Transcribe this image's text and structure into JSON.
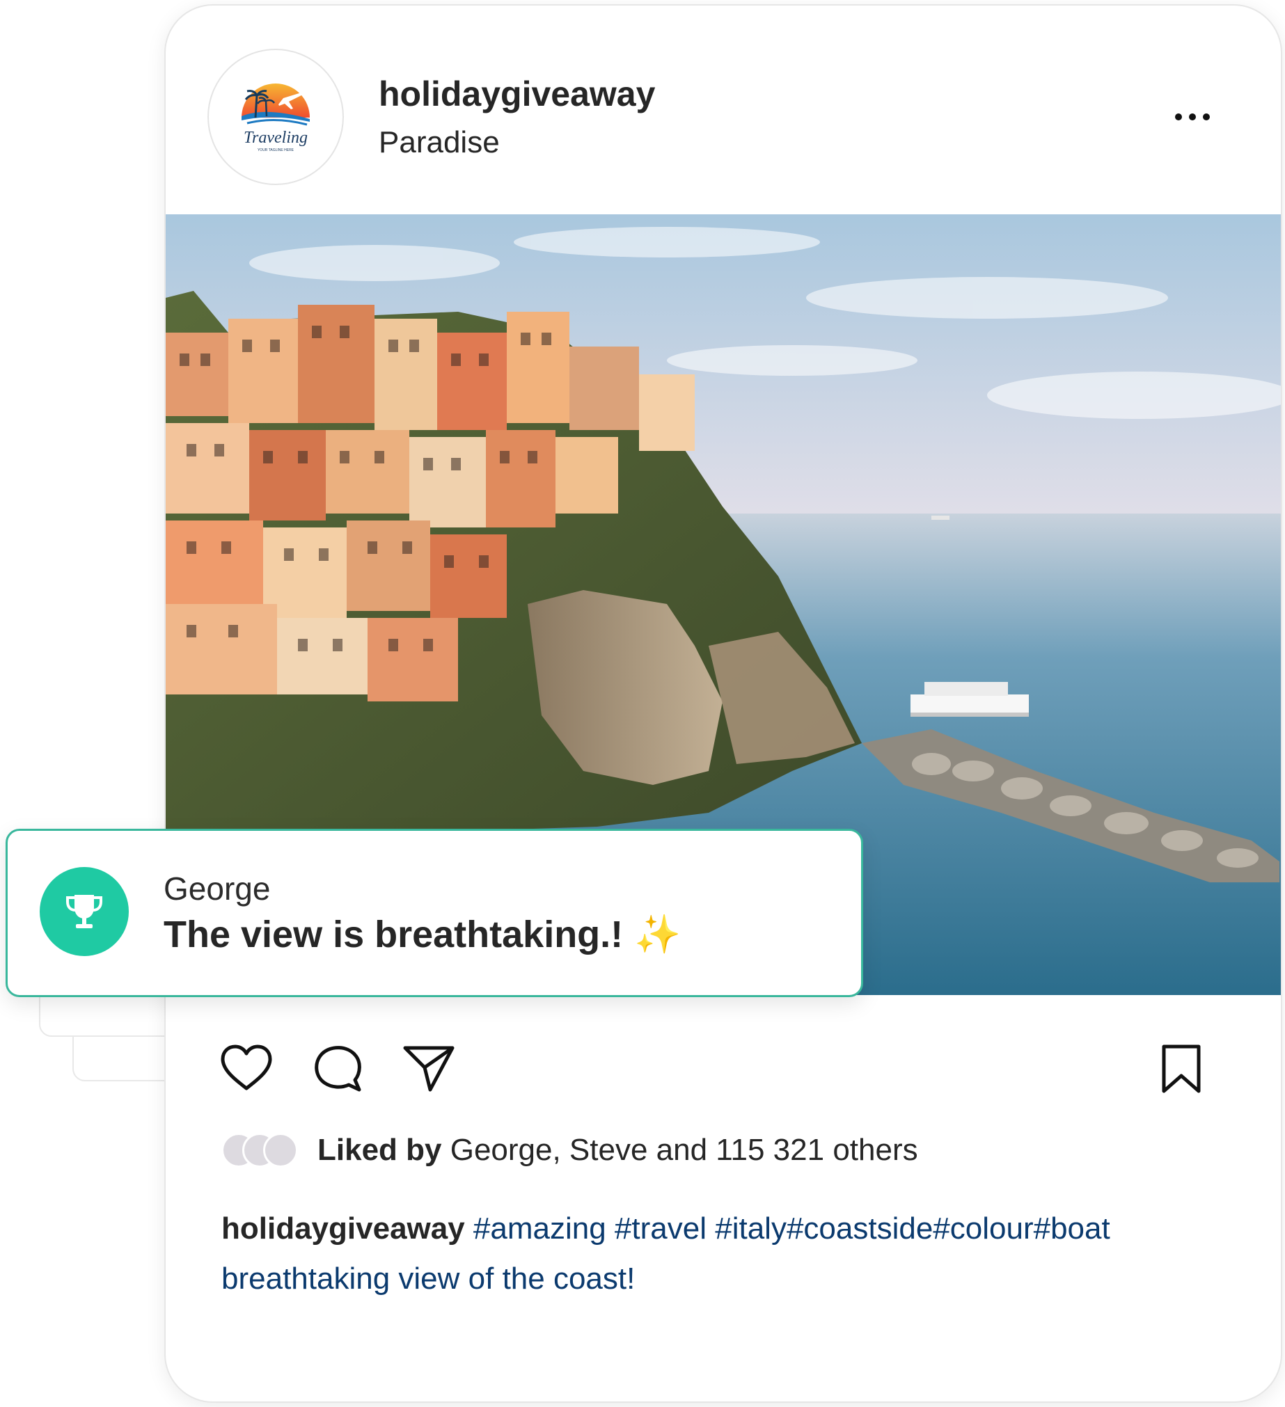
{
  "post": {
    "username": "holidaygiveaway",
    "location": "Paradise",
    "avatar_logo_text": "Traveling",
    "avatar_tagline": "YOUR TAGLINE HERE",
    "more_icon": "more-horizontal-icon",
    "image_alt_subject": "coastal village on cliffs by the sea",
    "actions": {
      "like_icon": "heart-icon",
      "comment_icon": "comment-bubble-icon",
      "share_icon": "paper-plane-icon",
      "save_icon": "bookmark-icon"
    },
    "likes": {
      "prefix": "Liked by",
      "text": " George, Steve and 115 321 others"
    },
    "caption": {
      "owner": "holidaygiveaway",
      "hashtags": " #amazing #travel #italy#coastside#colour#boat",
      "text": "breathtaking view of the coast!"
    }
  },
  "notification": {
    "icon": "trophy-icon",
    "name": "George",
    "message": "The view is breathtaking.!",
    "emoji": "✨"
  },
  "colors": {
    "accent": "#1fcaa3",
    "notification_border": "#39b79c",
    "hashtag": "#0b3a6e",
    "text": "#262626"
  }
}
